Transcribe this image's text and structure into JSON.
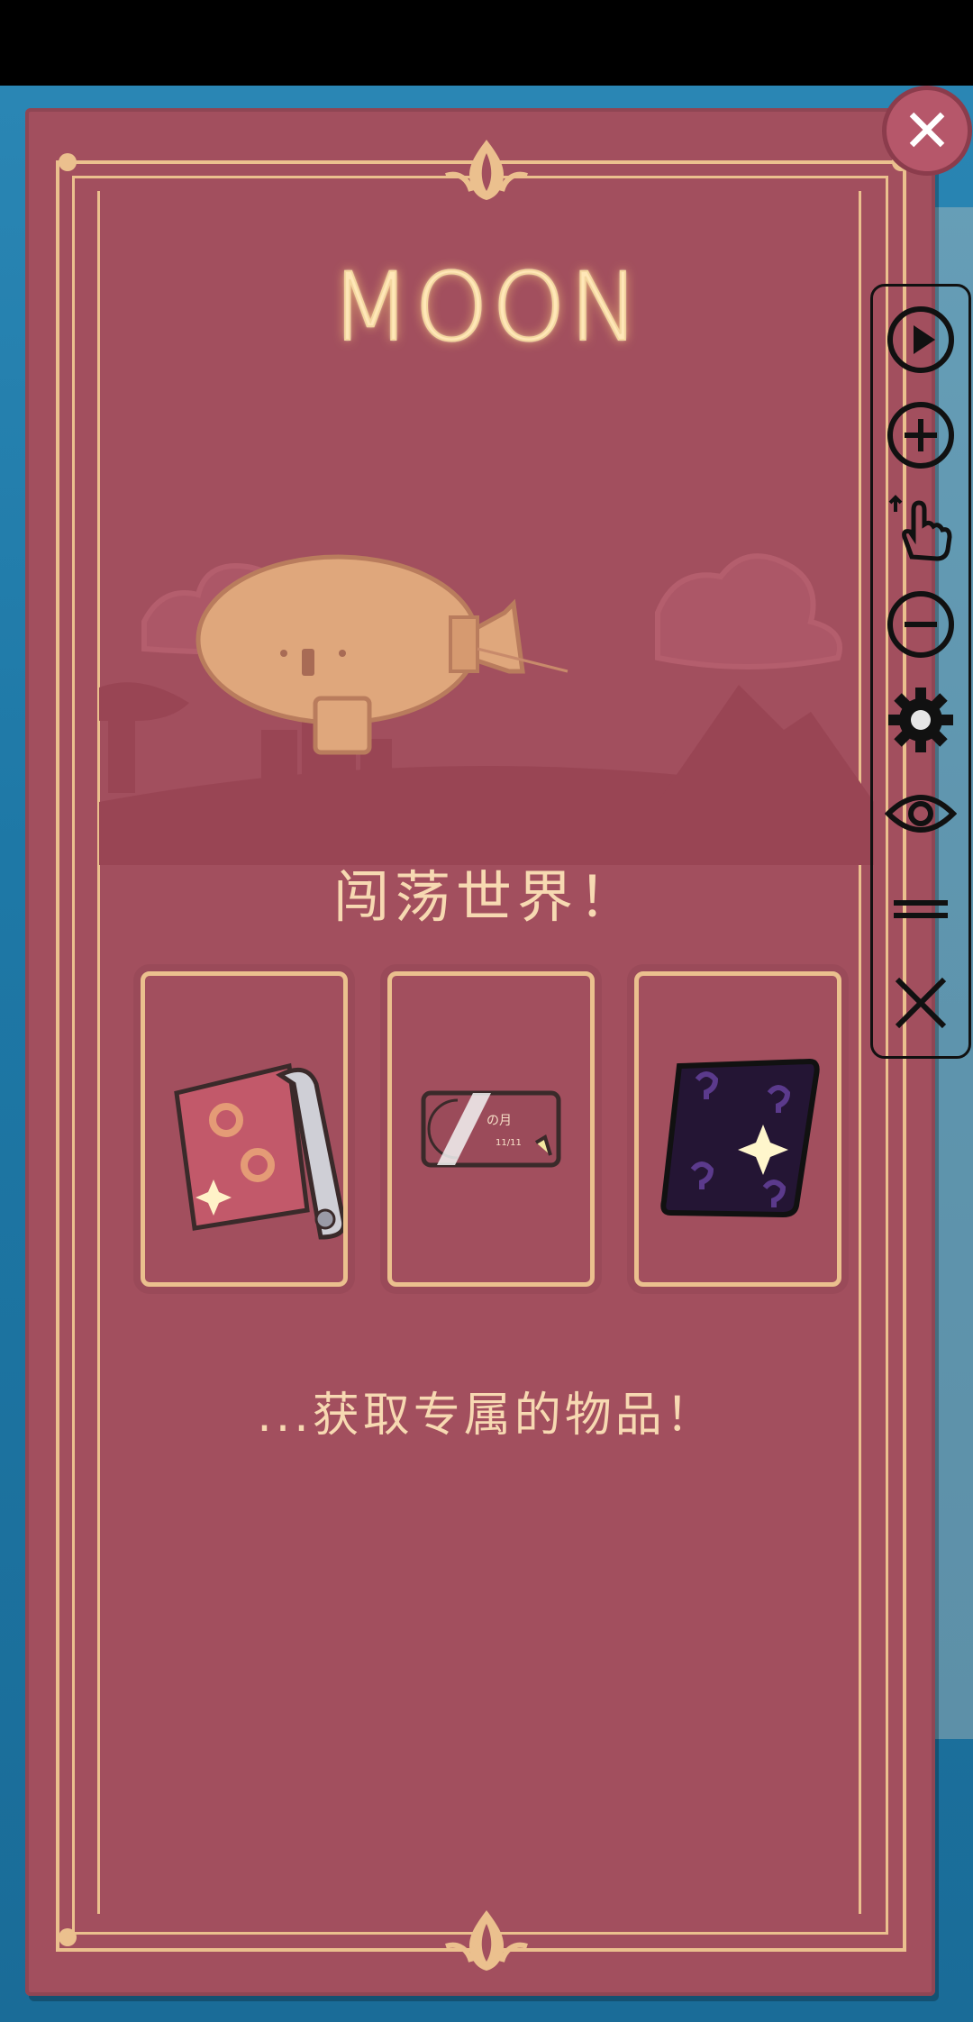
{
  "card": {
    "title": "MOON",
    "heading": "闯荡世界！",
    "footer": "...获取专属的物品！",
    "items": [
      {
        "name": "wallpaper-roll",
        "icon": "wallpaper-roll-icon"
      },
      {
        "name": "moon-ticket",
        "icon": "moon-ticket-icon",
        "ticket_text": "の月",
        "ticket_date": "11/11"
      },
      {
        "name": "mystery-book",
        "icon": "mystery-book-icon"
      }
    ]
  },
  "close_button": {
    "label": "✕"
  },
  "toolbar": {
    "tools": [
      "play-icon",
      "zoom-in-icon",
      "tap-hand-icon",
      "zoom-out-icon",
      "gear-icon",
      "eye-icon",
      "drag-handle-icon",
      "close-icon"
    ]
  },
  "colors": {
    "card": "#a24f5e",
    "gold": "#ebc08e",
    "text": "#f7d9b2"
  }
}
